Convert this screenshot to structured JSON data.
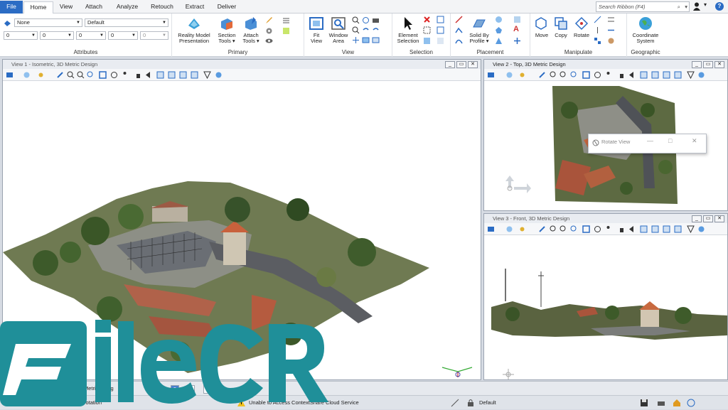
{
  "tabs": [
    {
      "label": "File"
    },
    {
      "label": "Home"
    },
    {
      "label": "View"
    },
    {
      "label": "Attach"
    },
    {
      "label": "Analyze"
    },
    {
      "label": "Retouch"
    },
    {
      "label": "Extract"
    },
    {
      "label": "Deliver"
    }
  ],
  "search": {
    "placeholder": "Search Ribbon (F4)"
  },
  "attributes": {
    "level": "None",
    "style": "Default",
    "row2": [
      "0",
      "0",
      "0",
      "0",
      "0"
    ],
    "group_label": "Attributes"
  },
  "primary": {
    "buttons": [
      {
        "l1": "Reality Model",
        "l2": "Presentation"
      },
      {
        "l1": "Section",
        "l2": "Tools ▾"
      },
      {
        "l1": "Attach",
        "l2": "Tools ▾"
      }
    ],
    "group_label": "Primary"
  },
  "view_group": {
    "buttons": [
      {
        "l1": "Fit",
        "l2": "View"
      },
      {
        "l1": "Window",
        "l2": "Area"
      }
    ],
    "group_label": "View"
  },
  "selection": {
    "buttons": [
      {
        "l1": "Element",
        "l2": "Selection"
      }
    ],
    "group_label": "Selection"
  },
  "placement": {
    "buttons": [
      {
        "l1": "Solid By",
        "l2": "Profile ▾"
      }
    ],
    "group_label": "Placement"
  },
  "manipulate": {
    "buttons": [
      {
        "l1": "Move"
      },
      {
        "l1": "Copy"
      },
      {
        "l1": "Rotate"
      }
    ],
    "group_label": "Manipulate"
  },
  "geographic": {
    "buttons": [
      {
        "l1": "Coordinate",
        "l2": "System"
      }
    ],
    "group_label": "Geographic"
  },
  "views": [
    {
      "title": "View 1 - Isometric, 3D Metric Design"
    },
    {
      "title": "View 2 - Top, 3D Metric Design"
    },
    {
      "title": "View 3 - Front, 3D Metric Design"
    }
  ],
  "dialog": {
    "title": "Rotate View"
  },
  "statusbar": {
    "model_label": "Metric Desig",
    "view_numbers": [
      "2",
      "3",
      "6"
    ],
    "left_prompt": "rotation",
    "message": "Unable to Access ContextShare Cloud Service",
    "level_value": "Default"
  },
  "watermark": {
    "text": "FileCR"
  },
  "colors": {
    "accent": "#2b6cc4",
    "logo": "#1f8f99"
  }
}
